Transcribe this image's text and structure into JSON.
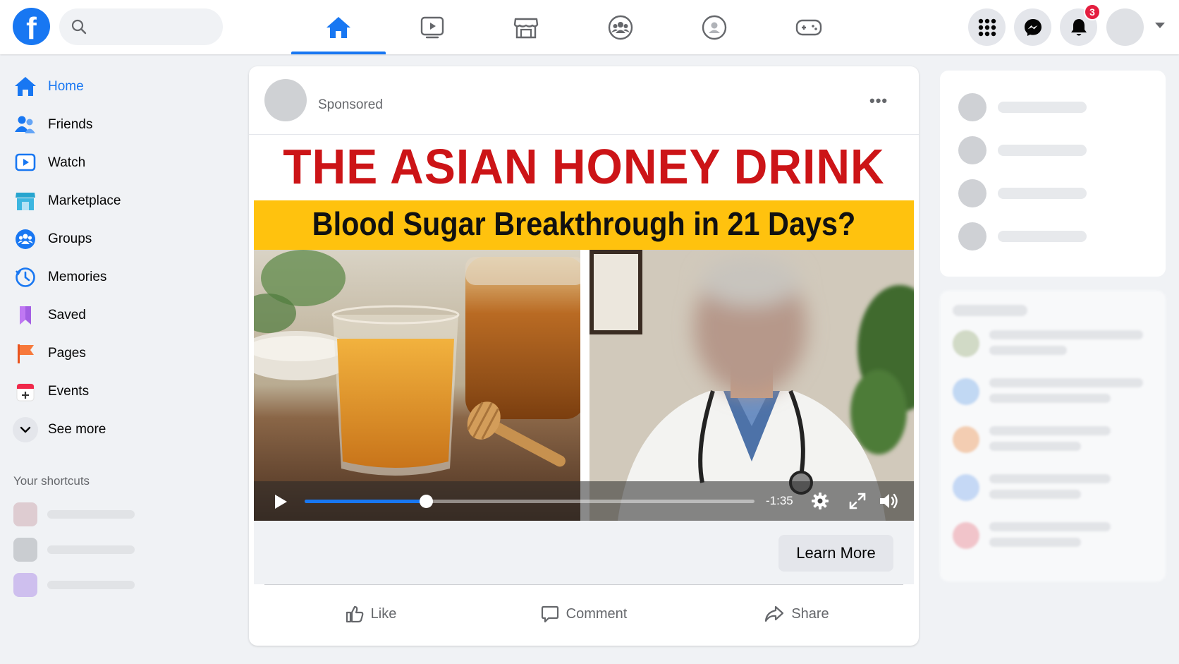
{
  "topbar": {
    "logo": "f",
    "search_placeholder": "",
    "nav_tabs": [
      {
        "name": "home",
        "icon": "home-icon",
        "active": true
      },
      {
        "name": "watch",
        "icon": "watch-icon",
        "active": false
      },
      {
        "name": "marketplace",
        "icon": "marketplace-icon",
        "active": false
      },
      {
        "name": "groups",
        "icon": "groups-icon",
        "active": false
      },
      {
        "name": "gaming-profile",
        "icon": "profile-circle-icon",
        "active": false
      },
      {
        "name": "gaming",
        "icon": "gamepad-icon",
        "active": false
      }
    ],
    "notification_count": "3",
    "accent_color": "#1877f2"
  },
  "sidebar": {
    "items": [
      {
        "label": "Home",
        "icon": "home-icon",
        "active": true
      },
      {
        "label": "Friends",
        "icon": "friends-icon"
      },
      {
        "label": "Watch",
        "icon": "watch-icon"
      },
      {
        "label": "Marketplace",
        "icon": "marketplace-icon"
      },
      {
        "label": "Groups",
        "icon": "groups-icon"
      },
      {
        "label": "Memories",
        "icon": "memories-clock-icon"
      },
      {
        "label": "Saved",
        "icon": "bookmark-icon"
      },
      {
        "label": "Pages",
        "icon": "flag-icon"
      },
      {
        "label": "Events",
        "icon": "calendar-plus-icon"
      },
      {
        "label": "See more",
        "icon": "chevron-down-icon"
      }
    ],
    "shortcuts_title": "Your shortcuts"
  },
  "post": {
    "sponsored_label": "Sponsored",
    "more_label": "•••",
    "ad_headline": "THE ASIAN HONEY DRINK",
    "ad_subheadline": "Blood Sugar Breakthrough in 21 Days?",
    "video": {
      "progress": 0.27,
      "time_remaining": "-1:35"
    },
    "cta_label": "Learn More",
    "actions": {
      "like": "Like",
      "comment": "Comment",
      "share": "Share"
    }
  }
}
